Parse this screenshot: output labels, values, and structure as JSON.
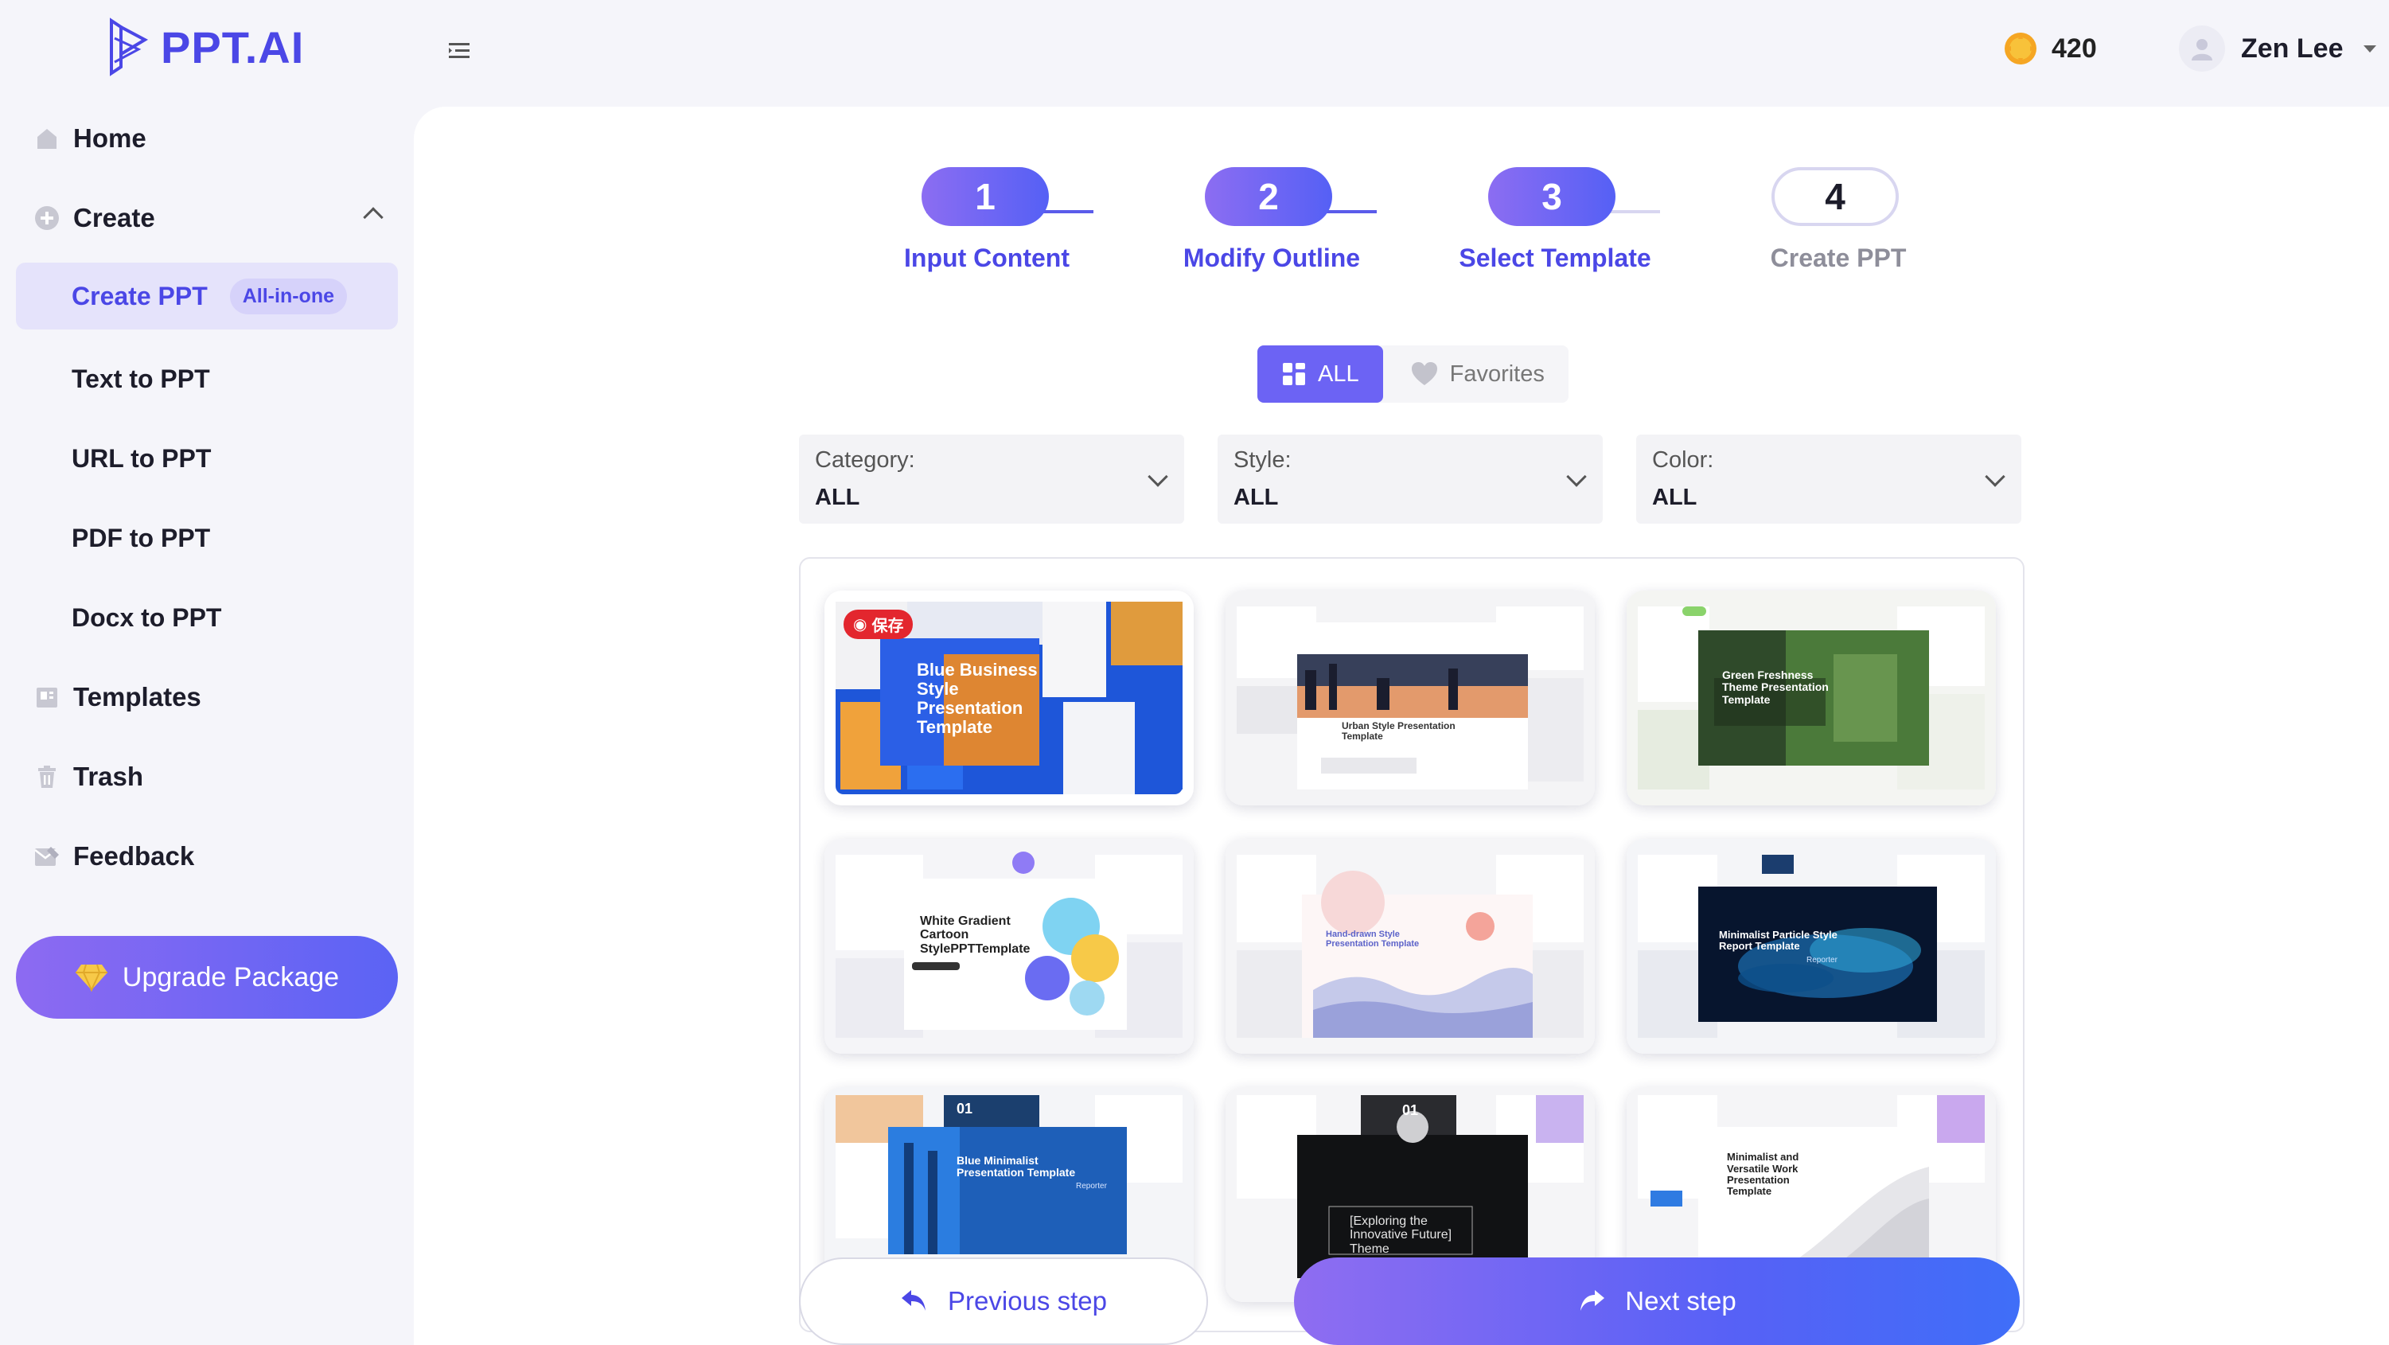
{
  "app": {
    "logo_text": "PPT.AI",
    "coins": "420",
    "user_name": "Zen Lee",
    "brand_color": "#4b47e6",
    "accent_gradient": [
      "#8c6df2",
      "#5560f5"
    ]
  },
  "sidebar": {
    "items": [
      {
        "label": "Home",
        "icon": "home-icon"
      },
      {
        "label": "Create",
        "icon": "plus-circle-icon",
        "expanded": true
      },
      {
        "label": "Create PPT",
        "badge": "All-in-one",
        "active": true
      },
      {
        "label": "Text to PPT"
      },
      {
        "label": "URL to PPT"
      },
      {
        "label": "PDF to PPT"
      },
      {
        "label": "Docx to PPT"
      },
      {
        "label": "Templates",
        "icon": "templates-icon"
      },
      {
        "label": "Trash",
        "icon": "trash-icon"
      },
      {
        "label": "Feedback",
        "icon": "feedback-icon"
      }
    ],
    "upgrade_label": "Upgrade Package"
  },
  "stepper": {
    "steps": [
      {
        "num": "1",
        "label": "Input Content",
        "state": "done"
      },
      {
        "num": "2",
        "label": "Modify Outline",
        "state": "done"
      },
      {
        "num": "3",
        "label": "Select Template",
        "state": "done"
      },
      {
        "num": "4",
        "label": "Create PPT",
        "state": "todo"
      }
    ]
  },
  "tabs": {
    "all_label": "ALL",
    "favorites_label": "Favorites",
    "active": "ALL"
  },
  "filters": [
    {
      "label": "Category:",
      "value": "ALL"
    },
    {
      "label": "Style:",
      "value": "ALL"
    },
    {
      "label": "Color:",
      "value": "ALL"
    }
  ],
  "templates": [
    {
      "title": "Blue Business Style Presentation Template",
      "save_label": "保存",
      "theme": "blue-orange"
    },
    {
      "title": "Urban Style Presentation Template",
      "theme": "urban-white"
    },
    {
      "title": "Green Freshness Theme Presentation Template",
      "theme": "green"
    },
    {
      "title": "White Gradient Cartoon StylePPTTemplate",
      "theme": "white-gradient"
    },
    {
      "title": "Hand-drawn Style Presentation Template",
      "theme": "pink-handdrawn"
    },
    {
      "title": "Minimalist Particle Style Report Template",
      "sub": "Reporter",
      "theme": "dark-blue"
    },
    {
      "title": "Blue Minimalist Presentation Template",
      "number": "01",
      "sub": "Reporter",
      "theme": "blue-building"
    },
    {
      "title": "[Exploring the Innovative Future] Theme PPTTemplate",
      "number": "01",
      "theme": "space-dark"
    },
    {
      "title": "Minimalist and Versatile Work Presentation Template",
      "theme": "white-curve"
    }
  ],
  "footer": {
    "prev_label": "Previous step",
    "next_label": "Next step"
  }
}
